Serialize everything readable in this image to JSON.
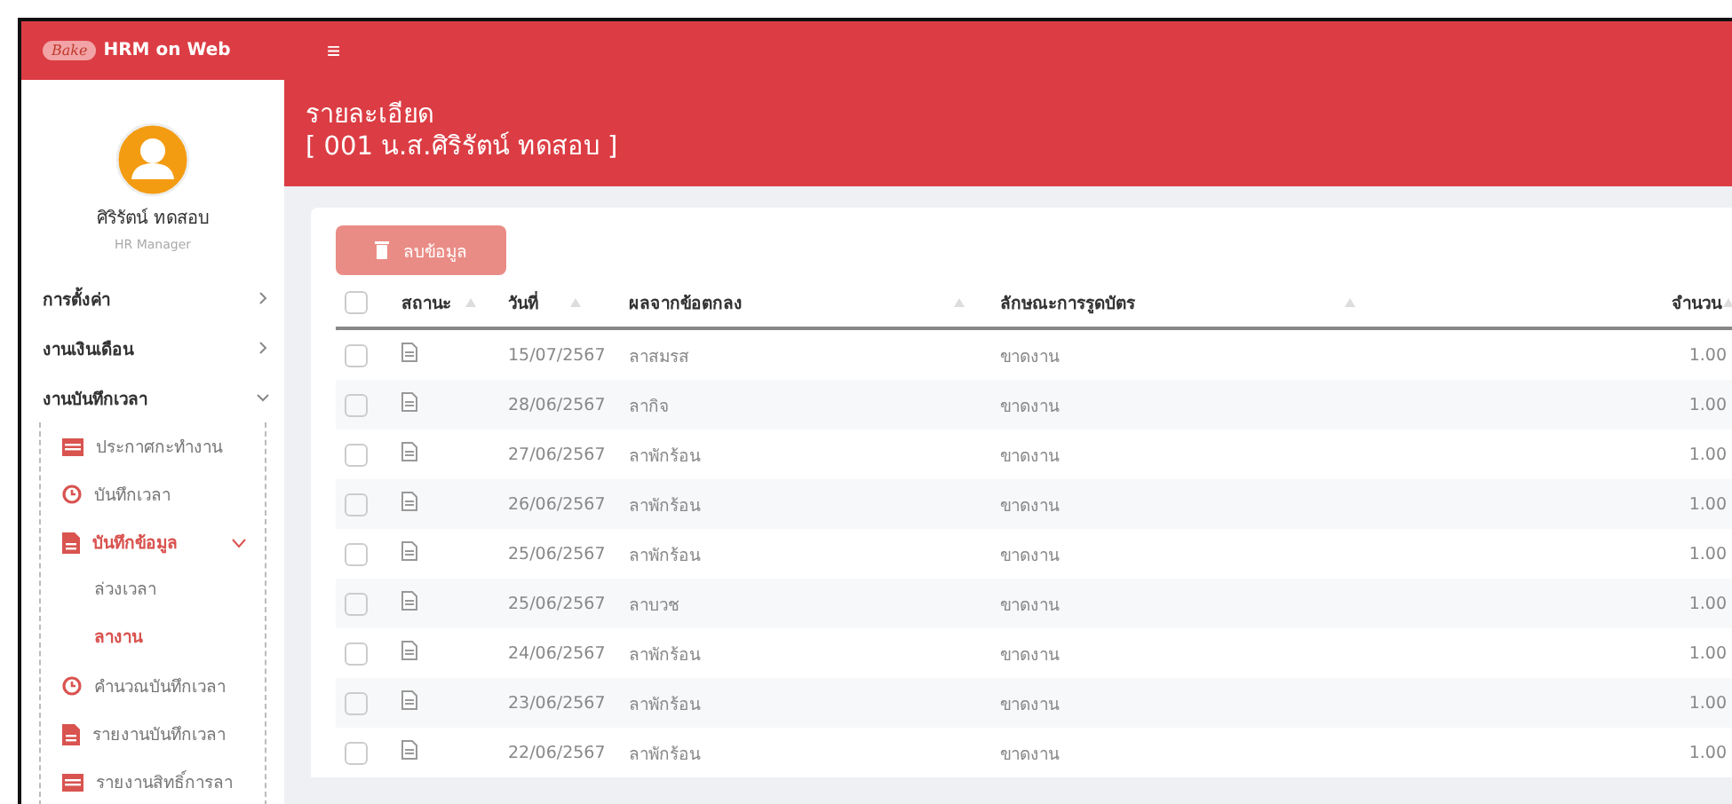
{
  "topbar": {
    "logo_text": "Bake",
    "app_name": "HRM on Web",
    "menu_glyph": "≡"
  },
  "sidebar": {
    "user_name": "ศิริรัตน์ ทดสอบ",
    "role": "HR Manager",
    "menu": [
      {
        "label": "การตั้งค่า",
        "expanded": false
      },
      {
        "label": "งานเงินเดือน",
        "expanded": false
      },
      {
        "label": "งานบันทึกเวลา",
        "expanded": true,
        "children": [
          {
            "label": "ประกาศกะทำงาน",
            "kind": "calendar",
            "active": false
          },
          {
            "label": "บันทึกเวลา",
            "kind": "clock",
            "active": false
          },
          {
            "label": "บันทึกข้อมูล",
            "kind": "document",
            "active": true,
            "expanded": true,
            "children": [
              {
                "label": "ล่วงเวลา",
                "active": false
              },
              {
                "label": "ลางาน",
                "active": true
              }
            ]
          },
          {
            "label": "คำนวณบันทึกเวลา",
            "kind": "clock",
            "active": false
          },
          {
            "label": "รายงานบันทึกเวลา",
            "kind": "document",
            "active": false
          },
          {
            "label": "รายงานสิทธิ์การลา",
            "kind": "calendar",
            "active": false
          }
        ]
      }
    ]
  },
  "page_header": {
    "title": "รายละเอียด",
    "subtitle": "[ 001 น.ส.ศิริรัตน์ ทดสอบ ]"
  },
  "delete_button": {
    "label": "ลบข้อมูล",
    "disabled": true
  },
  "table": {
    "select_all_checked": false,
    "columns": [
      "สถานะ",
      "วันที่",
      "ผลจากข้อตกลง",
      "ลักษณะการรูดบัตร",
      "จำนวน"
    ],
    "rows": [
      {
        "checked": false,
        "date": "15/07/2567",
        "agreement": "ลาสมรส",
        "swipe_type": "ขาดงาน",
        "amount": "1.00"
      },
      {
        "checked": false,
        "date": "28/06/2567",
        "agreement": "ลากิจ",
        "swipe_type": "ขาดงาน",
        "amount": "1.00"
      },
      {
        "checked": false,
        "date": "27/06/2567",
        "agreement": "ลาพักร้อน",
        "swipe_type": "ขาดงาน",
        "amount": "1.00"
      },
      {
        "checked": false,
        "date": "26/06/2567",
        "agreement": "ลาพักร้อน",
        "swipe_type": "ขาดงาน",
        "amount": "1.00"
      },
      {
        "checked": false,
        "date": "25/06/2567",
        "agreement": "ลาพักร้อน",
        "swipe_type": "ขาดงาน",
        "amount": "1.00"
      },
      {
        "checked": false,
        "date": "25/06/2567",
        "agreement": "ลาบวช",
        "swipe_type": "ขาดงาน",
        "amount": "1.00"
      },
      {
        "checked": false,
        "date": "24/06/2567",
        "agreement": "ลาพักร้อน",
        "swipe_type": "ขาดงาน",
        "amount": "1.00"
      },
      {
        "checked": false,
        "date": "23/06/2567",
        "agreement": "ลาพักร้อน",
        "swipe_type": "ขาดงาน",
        "amount": "1.00"
      },
      {
        "checked": false,
        "date": "22/06/2567",
        "agreement": "ลาพักร้อน",
        "swipe_type": "ขาดงาน",
        "amount": "1.00"
      }
    ]
  }
}
